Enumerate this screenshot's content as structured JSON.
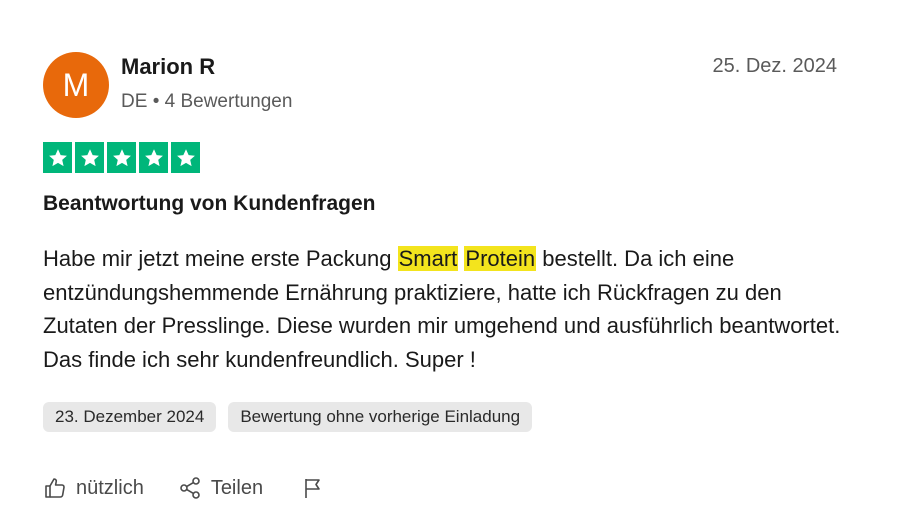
{
  "reviewer": {
    "initial": "M",
    "name": "Marion R",
    "country": "DE",
    "separator": "•",
    "reviews_count": "4 Bewertungen",
    "avatar_color": "#e8690b"
  },
  "review_date": "25. Dez. 2024",
  "rating": {
    "stars": 5,
    "max": 5,
    "color": "#00b67a"
  },
  "review": {
    "title": "Beantwortung von Kundenfragen",
    "body_part1": "Habe mir jetzt meine erste Packung ",
    "highlight1": "Smart",
    "space": " ",
    "highlight2": "Protein",
    "body_part2": " bestellt. Da ich eine entzündungshemmende Ernährung praktiziere, hatte ich Rückfragen zu den Zutaten der Presslinge. Diese wurden mir umgehend und ausführlich beantwortet. Das finde ich sehr kundenfreundlich. Super !",
    "highlight_color": "#f3e41d"
  },
  "tags": {
    "experience_date": "23. Dezember 2024",
    "invitation": "Bewertung ohne vorherige Einladung"
  },
  "actions": {
    "useful_label": "nützlich",
    "share_label": "Teilen",
    "useful_icon": "thumbs-up-icon",
    "share_icon": "share-icon",
    "report_icon": "flag-icon"
  }
}
